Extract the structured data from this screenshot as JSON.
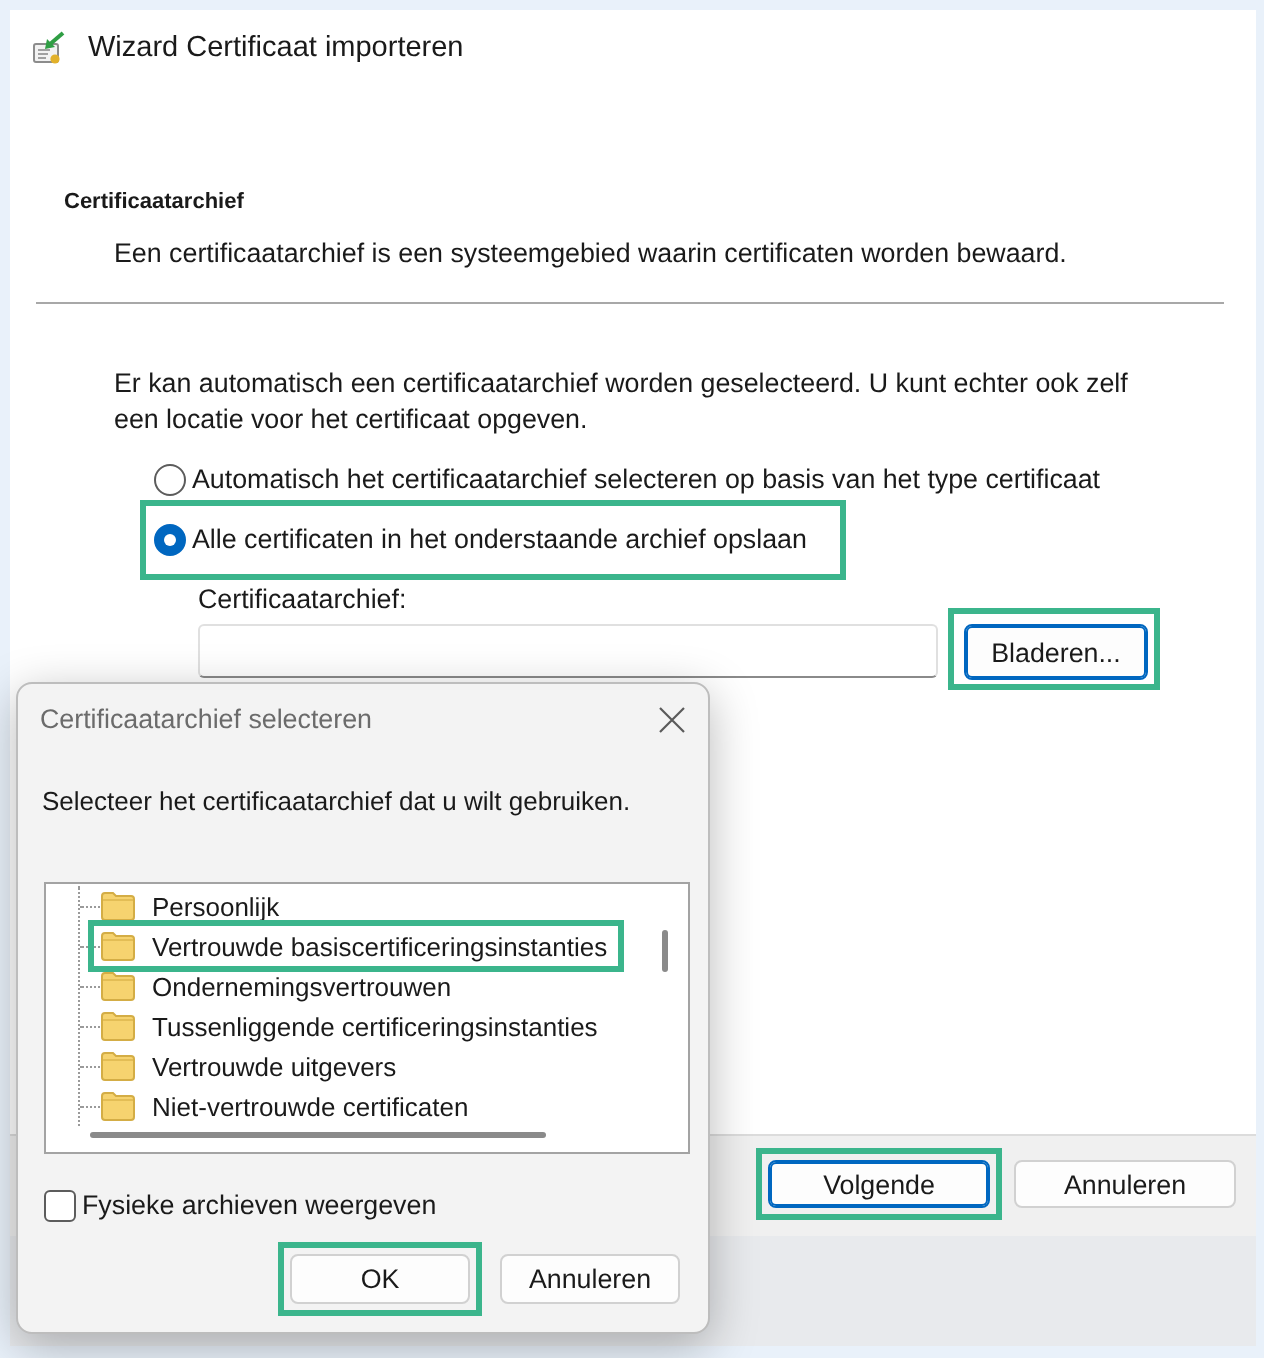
{
  "wizard": {
    "title": "Wizard Certificaat importeren",
    "section_title": "Certificaatarchief",
    "section_description": "Een certificaatarchief is een systeemgebied waarin certificaten worden bewaard.",
    "intro": "Er kan automatisch een certificaatarchief worden geselecteerd. U kunt echter ook zelf een locatie voor het certificaat opgeven.",
    "options": [
      {
        "label": "Automatisch het certificaatarchief selecteren op basis van het type certificaat",
        "selected": false,
        "highlighted": false
      },
      {
        "label": "Alle certificaten in het onderstaande archief opslaan",
        "selected": true,
        "highlighted": true
      }
    ],
    "store_field": {
      "label": "Certificaatarchief:"
    },
    "browse_button": {
      "label": "Bladeren...",
      "focused": true,
      "highlighted": true
    },
    "buttons": [
      {
        "label": "Volgende",
        "focused": true,
        "highlighted": true
      },
      {
        "label": "Annuleren",
        "focused": false,
        "highlighted": false
      }
    ]
  },
  "dialog": {
    "title": "Certificaatarchief selecteren",
    "prompt": "Selecteer het certificaatarchief dat u wilt gebruiken.",
    "tree": [
      {
        "label": "Persoonlijk",
        "selected": false,
        "highlighted": false
      },
      {
        "label": "Vertrouwde basiscertificeringsinstanties",
        "selected": false,
        "highlighted": true
      },
      {
        "label": "Ondernemingsvertrouwen",
        "selected": false,
        "highlighted": false
      },
      {
        "label": "Tussenliggende certificeringsinstanties",
        "selected": false,
        "highlighted": false
      },
      {
        "label": "Vertrouwde uitgevers",
        "selected": false,
        "highlighted": false
      },
      {
        "label": "Niet-vertrouwde certificaten",
        "selected": false,
        "highlighted": false
      }
    ],
    "checkbox": {
      "label": "Fysieke archieven weergeven",
      "checked": false
    },
    "buttons": [
      {
        "label": "OK",
        "focused": false,
        "highlighted": true
      },
      {
        "label": "Annuleren",
        "focused": false,
        "highlighted": false
      }
    ]
  }
}
